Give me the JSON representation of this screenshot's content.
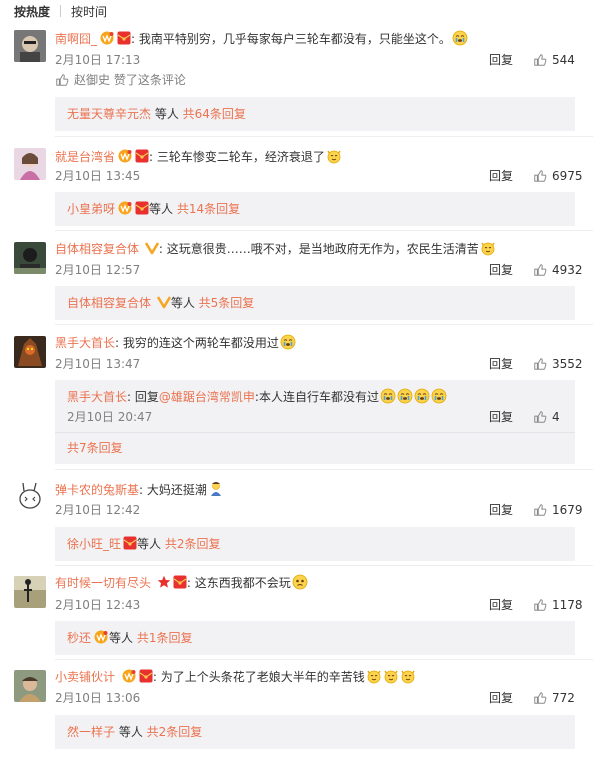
{
  "tabs": [
    "按热度",
    "按时间"
  ],
  "comments": [
    {
      "username": "南啊囧_",
      "text": "我南平特别穷，几乎每家每户三轮车都没有，只能坐这个。",
      "date": "2月10日 17:13",
      "reply_label": "回复",
      "likes": "544",
      "liked_by": "赵御史 赞了这条评论",
      "sub_prefix": "无量天尊辛元杰",
      "sub_mid": " 等人 ",
      "sub_count": "共64条回复"
    },
    {
      "username": "就是台湾省",
      "text": "三轮车惨变二轮车，经济衰退了",
      "date": "2月10日 13:45",
      "reply_label": "回复",
      "likes": "6975",
      "sub_prefix": "小皇弟呀",
      "sub_mid": "等人 ",
      "sub_count": "共14条回复"
    },
    {
      "username": "自体相容复合体",
      "text": "这玩意很贵……哦不对，是当地政府无作为，农民生活清苦",
      "date": "2月10日 12:57",
      "reply_label": "回复",
      "likes": "4932",
      "sub_prefix": "自体相容复合体",
      "sub_mid": "等人 ",
      "sub_count": "共5条回复"
    },
    {
      "username": "黑手大首长",
      "text": "我穷的连这个两轮车都没用过",
      "date": "2月10日 13:47",
      "reply_label": "回复",
      "likes": "3552",
      "reply": {
        "username": "黑手大首长",
        "prefix": "回复",
        "mention": "@雄踞台湾常凯申",
        "text": ":本人连自行车都没有过",
        "date": "2月10日 20:47",
        "reply_label": "回复",
        "likes": "4"
      },
      "sub_count": "共7条回复"
    },
    {
      "username": "弹卡农的兔斯基",
      "text": "大妈还挺潮",
      "date": "2月10日 12:42",
      "reply_label": "回复",
      "likes": "1679",
      "sub_prefix": "徐小旺_旺",
      "sub_mid": "等人 ",
      "sub_count": "共2条回复"
    },
    {
      "username": "有时候一切有尽头",
      "text": "这东西我都不会玩",
      "date": "2月10日 12:43",
      "reply_label": "回复",
      "likes": "1178",
      "sub_prefix": "秒还",
      "sub_mid": "等人 ",
      "sub_count": "共1条回复"
    },
    {
      "username": "小卖铺伙计",
      "text": "为了上个头条花了老娘大半年的辛苦钱",
      "date": "2月10日 13:06",
      "reply_label": "回复",
      "likes": "772",
      "sub_prefix": "然一样子",
      "sub_mid": " 等人 ",
      "sub_count": "共2条回复"
    }
  ],
  "colors": {
    "accent": "#eb7350",
    "subbox": "#f2f2f5",
    "meta": "#808080",
    "link": "#eb7350"
  },
  "icons": [
    "thumb-up-icon",
    "vip-badge-icon",
    "red-envelope-icon",
    "v-verified-icon",
    "red-star-icon",
    "emoji-icon"
  ]
}
